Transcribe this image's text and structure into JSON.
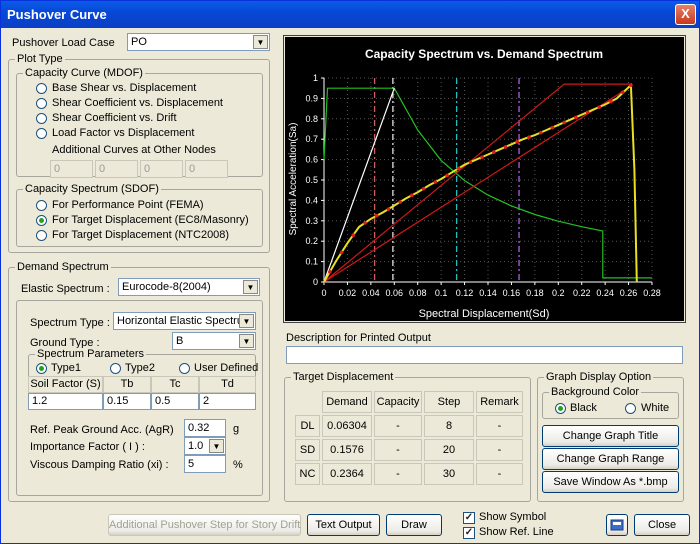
{
  "window": {
    "title": "Pushover Curve",
    "close_glyph": "X"
  },
  "load_case": {
    "label": "Pushover Load Case",
    "value": "PO"
  },
  "plot_type": {
    "title": "Plot Type",
    "capacity_curve": {
      "title": "Capacity Curve (MDOF)",
      "options": [
        "Base Shear vs. Displacement",
        "Shear Coefficient vs. Displacement",
        "Shear Coefficient vs. Drift",
        "Load Factor vs Displacement"
      ],
      "additional_label": "Additional Curves at Other Nodes",
      "additional_values": [
        "0",
        "0",
        "0",
        "0"
      ]
    },
    "capacity_spectrum": {
      "title": "Capacity Spectrum (SDOF)",
      "options": [
        "For Performance Point (FEMA)",
        "For Target Displacement (EC8/Masonry)",
        "For Target Displacement (NTC2008)"
      ],
      "selected": 1
    }
  },
  "demand": {
    "title": "Demand Spectrum",
    "elastic_label": "Elastic Spectrum :",
    "elastic_value": "Eurocode-8(2004)",
    "spectrum_type_label": "Spectrum Type :",
    "spectrum_type_value": "Horizontal Elastic Spectrum",
    "ground_type_label": "Ground Type :",
    "ground_type_value": "B",
    "params_title": "Spectrum Parameters",
    "param_options": [
      "Type1",
      "Type2",
      "User Defined"
    ],
    "param_selected": 0,
    "table_headers": [
      "Soil Factor (S)",
      "Tb",
      "Tc",
      "Td"
    ],
    "table_values": [
      "1.2",
      "0.15",
      "0.5",
      "2"
    ],
    "agr_label": "Ref. Peak Ground Acc. (AgR)",
    "agr_value": "0.32",
    "agr_unit": "g",
    "importance_label": "Importance Factor ( I ) :",
    "importance_value": "1.0",
    "damping_label": "Viscous Damping Ratio (xi) :",
    "damping_value": "5",
    "damping_unit": "%"
  },
  "chart_data": {
    "type": "line",
    "title": "Capacity Spectrum vs. Demand Spectrum",
    "xlabel": "Spectral Displacement(Sd)",
    "ylabel": "Spectral Acceleration(Sa)",
    "xlim": [
      0,
      0.28
    ],
    "ylim": [
      0,
      1
    ],
    "xticks": [
      "0",
      "0.02",
      "0.04",
      "0.06",
      "0.08",
      "0.1",
      "0.12",
      "0.14",
      "0.16",
      "0.18",
      "0.2",
      "0.22",
      "0.24",
      "0.26",
      "0.28"
    ],
    "yticks": [
      "0",
      "0.1",
      "0.2",
      "0.3",
      "0.4",
      "0.5",
      "0.6",
      "0.7",
      "0.8",
      "0.9",
      "1"
    ],
    "grid": true,
    "background": "#000000",
    "series": [
      {
        "color": "#22c022",
        "x": [
          0,
          0.003,
          0.06,
          0.08,
          0.1,
          0.12,
          0.14,
          0.16,
          0.18,
          0.2,
          0.22,
          0.238,
          0.238,
          0.28
        ],
        "y": [
          0.6,
          0.95,
          0.95,
          0.745,
          0.596,
          0.497,
          0.426,
          0.373,
          0.331,
          0.298,
          0.271,
          0.25,
          0.02,
          0.02
        ]
      },
      {
        "color": "#ffffff",
        "x": [
          0,
          0.06
        ],
        "y": [
          0,
          0.95
        ]
      },
      {
        "color": "#d01818",
        "x": [
          0,
          0.262
        ],
        "y": [
          0,
          0.96
        ]
      },
      {
        "color": "#d01818",
        "x": [
          0,
          0.205,
          0.262
        ],
        "y": [
          0,
          0.97,
          0.97
        ]
      },
      {
        "color": "#e8e020",
        "x": [
          0,
          0.01,
          0.02,
          0.03,
          0.04,
          0.05,
          0.06,
          0.07,
          0.08,
          0.09,
          0.1,
          0.11,
          0.12,
          0.13,
          0.14,
          0.15,
          0.16,
          0.17,
          0.18,
          0.19,
          0.2,
          0.21,
          0.22,
          0.23,
          0.24,
          0.25,
          0.262,
          0.265,
          0.267
        ],
        "y": [
          0,
          0.1,
          0.19,
          0.27,
          0.31,
          0.34,
          0.375,
          0.41,
          0.44,
          0.475,
          0.505,
          0.54,
          0.575,
          0.6,
          0.625,
          0.65,
          0.675,
          0.7,
          0.72,
          0.745,
          0.77,
          0.795,
          0.82,
          0.845,
          0.87,
          0.9,
          0.965,
          0.55,
          0.0
        ]
      }
    ],
    "markers": {
      "color": "#e02020",
      "x": [
        0.005,
        0.015,
        0.025,
        0.035,
        0.045,
        0.055,
        0.065,
        0.075,
        0.085,
        0.095,
        0.105,
        0.115,
        0.125,
        0.135,
        0.145,
        0.155,
        0.165,
        0.175,
        0.185,
        0.195,
        0.205,
        0.215,
        0.225,
        0.235,
        0.245,
        0.255,
        0.262
      ],
      "y": [
        0.05,
        0.145,
        0.23,
        0.29,
        0.325,
        0.357,
        0.392,
        0.425,
        0.457,
        0.49,
        0.522,
        0.557,
        0.587,
        0.612,
        0.637,
        0.662,
        0.687,
        0.71,
        0.732,
        0.757,
        0.782,
        0.807,
        0.832,
        0.857,
        0.885,
        0.93,
        0.965
      ]
    },
    "vlines": [
      {
        "x": 0.0432,
        "color": "#d06060"
      },
      {
        "x": 0.0588,
        "color": "#e0e0e0"
      },
      {
        "x": 0.1132,
        "color": "#20c0c0"
      },
      {
        "x": 0.1665,
        "color": "#b060e0"
      }
    ]
  },
  "description": {
    "label": "Description for Printed Output",
    "value": ""
  },
  "target": {
    "title": "Target Displacement",
    "headers": [
      "Demand",
      "Capacity",
      "Step",
      "Remark"
    ],
    "rows": [
      {
        "name": "DL",
        "demand": "0.06304",
        "capacity": "-",
        "step": "8",
        "remark": "-"
      },
      {
        "name": "SD",
        "demand": "0.1576",
        "capacity": "-",
        "step": "20",
        "remark": "-"
      },
      {
        "name": "NC",
        "demand": "0.2364",
        "capacity": "-",
        "step": "30",
        "remark": "-"
      }
    ]
  },
  "graph_option": {
    "title": "Graph Display Option",
    "bg_title": "Background Color",
    "bg_options": [
      "Black",
      "White"
    ],
    "bg_selected": 0,
    "buttons": [
      "Change Graph Title",
      "Change Graph Range",
      "Save Window As *.bmp"
    ]
  },
  "bottom": {
    "additional_step": "Additional Pushover Step for Story Drift",
    "text_output": "Text Output",
    "draw": "Draw",
    "show_symbol": "Show Symbol",
    "show_ref_line": "Show Ref. Line",
    "close": "Close",
    "check_glyph": "✓"
  }
}
